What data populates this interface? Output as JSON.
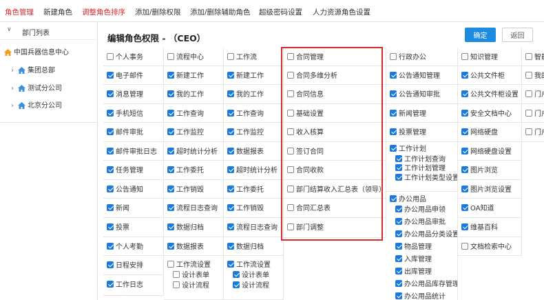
{
  "topnav": {
    "items": [
      "角色管理",
      "新建角色",
      "调整角色排序",
      "添加/删除权限",
      "添加/删除辅助角色",
      "超级密码设置",
      "人力资源角色设置"
    ]
  },
  "sidebar": {
    "title": "部门列表",
    "root": "中国兵器信息中心",
    "nodes": [
      "集团总部",
      "测试分公司",
      "北京分公司"
    ]
  },
  "main": {
    "title": "编辑角色权限 - （CEO）",
    "confirm_label": "确定",
    "return_label": "返回"
  },
  "columns": [
    {
      "cells": [
        {
          "items": [
            {
              "label": "个人事务",
              "checked": false
            }
          ]
        },
        {
          "items": [
            {
              "label": "电子邮件",
              "checked": true
            }
          ]
        },
        {
          "items": [
            {
              "label": "消息管理",
              "checked": true
            }
          ]
        },
        {
          "items": [
            {
              "label": "手机短信",
              "checked": true
            }
          ]
        },
        {
          "items": [
            {
              "label": "邮件审批",
              "checked": true
            }
          ]
        },
        {
          "items": [
            {
              "label": "邮件审批日志",
              "checked": true
            }
          ]
        },
        {
          "items": [
            {
              "label": "任务管理",
              "checked": true
            }
          ]
        },
        {
          "items": [
            {
              "label": "公告通知",
              "checked": true
            }
          ]
        },
        {
          "items": [
            {
              "label": "新闻",
              "checked": true
            }
          ]
        },
        {
          "items": [
            {
              "label": "投票",
              "checked": true
            }
          ]
        },
        {
          "items": [
            {
              "label": "个人考勤",
              "checked": true
            }
          ]
        },
        {
          "items": [
            {
              "label": "日程安排",
              "checked": true
            }
          ]
        },
        {
          "items": [
            {
              "label": "工作日志",
              "checked": true
            }
          ]
        }
      ]
    },
    {
      "cells": [
        {
          "items": [
            {
              "label": "流程中心",
              "checked": false
            }
          ]
        },
        {
          "items": [
            {
              "label": "新建工作",
              "checked": true
            }
          ]
        },
        {
          "items": [
            {
              "label": "我的工作",
              "checked": true
            }
          ]
        },
        {
          "items": [
            {
              "label": "工作查询",
              "checked": true
            }
          ]
        },
        {
          "items": [
            {
              "label": "工作监控",
              "checked": true
            }
          ]
        },
        {
          "items": [
            {
              "label": "超时统计分析",
              "checked": true
            }
          ]
        },
        {
          "items": [
            {
              "label": "工作委托",
              "checked": true
            }
          ]
        },
        {
          "items": [
            {
              "label": "工作销毁",
              "checked": true
            }
          ]
        },
        {
          "items": [
            {
              "label": "流程日志查询",
              "checked": true
            }
          ]
        },
        {
          "items": [
            {
              "label": "数据归档",
              "checked": true
            }
          ]
        },
        {
          "items": [
            {
              "label": "数据报表",
              "checked": true
            }
          ]
        },
        {
          "items": [
            {
              "label": "工作流设置",
              "checked": false
            },
            {
              "label": "设计表单",
              "checked": false
            },
            {
              "label": "设计流程",
              "checked": false
            }
          ]
        }
      ]
    },
    {
      "cells": [
        {
          "items": [
            {
              "label": "工作流",
              "checked": false
            }
          ]
        },
        {
          "items": [
            {
              "label": "新建工作",
              "checked": true
            }
          ]
        },
        {
          "items": [
            {
              "label": "我的工作",
              "checked": true
            }
          ]
        },
        {
          "items": [
            {
              "label": "工作查询",
              "checked": true
            }
          ]
        },
        {
          "items": [
            {
              "label": "工作监控",
              "checked": true
            }
          ]
        },
        {
          "items": [
            {
              "label": "数据报表",
              "checked": true
            }
          ]
        },
        {
          "items": [
            {
              "label": "超时统计分析",
              "checked": true
            }
          ]
        },
        {
          "items": [
            {
              "label": "工作委托",
              "checked": true
            }
          ]
        },
        {
          "items": [
            {
              "label": "工作销毁",
              "checked": true
            }
          ]
        },
        {
          "items": [
            {
              "label": "流程日志查询",
              "checked": true
            }
          ]
        },
        {
          "items": [
            {
              "label": "数据归档",
              "checked": true
            }
          ]
        },
        {
          "items": [
            {
              "label": "工作流设置",
              "checked": true
            },
            {
              "label": "设计表单",
              "checked": true
            },
            {
              "label": "设计流程",
              "checked": true
            }
          ]
        }
      ]
    },
    {
      "cells": [
        {
          "items": [
            {
              "label": "合同管理",
              "checked": false
            }
          ]
        },
        {
          "items": [
            {
              "label": "合同多维分析",
              "checked": false
            }
          ]
        },
        {
          "items": [
            {
              "label": "合同信息",
              "checked": false
            }
          ]
        },
        {
          "items": [
            {
              "label": "基础设置",
              "checked": false
            }
          ]
        },
        {
          "items": [
            {
              "label": "收入核算",
              "checked": false
            }
          ]
        },
        {
          "items": [
            {
              "label": "签订合同",
              "checked": false
            }
          ]
        },
        {
          "items": [
            {
              "label": "合同收款",
              "checked": false
            }
          ]
        },
        {
          "items": [
            {
              "label": "部门结算收入汇总表（领导）",
              "checked": false
            }
          ]
        },
        {
          "items": [
            {
              "label": "合同汇总表",
              "checked": false
            }
          ]
        },
        {
          "items": [
            {
              "label": "部门调整",
              "checked": false
            }
          ]
        }
      ]
    },
    {
      "cells": [
        {
          "items": [
            {
              "label": "行政办公",
              "checked": false
            }
          ]
        },
        {
          "items": [
            {
              "label": "公告通知管理",
              "checked": true
            }
          ]
        },
        {
          "items": [
            {
              "label": "公告通知审批",
              "checked": true
            }
          ]
        },
        {
          "items": [
            {
              "label": "新闻管理",
              "checked": true
            }
          ]
        },
        {
          "items": [
            {
              "label": "投票管理",
              "checked": true
            }
          ]
        },
        {
          "items": [
            {
              "label": "工作计划",
              "checked": true
            },
            {
              "label": "工作计划查询",
              "checked": true
            },
            {
              "label": "工作计划管理",
              "checked": true
            },
            {
              "label": "工作计划类型设置",
              "checked": true
            }
          ]
        },
        {
          "items": [
            {
              "label": "办公用品",
              "checked": true
            },
            {
              "label": "办公用品申领",
              "checked": true
            },
            {
              "label": "办公用品审批",
              "checked": true
            },
            {
              "label": "办公用品分类设置",
              "checked": true
            },
            {
              "label": "物品管理",
              "checked": true
            },
            {
              "label": "入库管理",
              "checked": true
            },
            {
              "label": "出库管理",
              "checked": true
            },
            {
              "label": "办公用品库存管理",
              "checked": true
            },
            {
              "label": "办公用品统计",
              "checked": true
            }
          ]
        }
      ]
    },
    {
      "cells": [
        {
          "items": [
            {
              "label": "知识管理",
              "checked": false
            }
          ]
        },
        {
          "items": [
            {
              "label": "公共文件柜",
              "checked": true
            }
          ]
        },
        {
          "items": [
            {
              "label": "公共文件柜设置",
              "checked": true
            }
          ]
        },
        {
          "items": [
            {
              "label": "安全文档中心",
              "checked": true
            }
          ]
        },
        {
          "items": [
            {
              "label": "网络硬盘",
              "checked": true
            }
          ]
        },
        {
          "items": [
            {
              "label": "网络硬盘设置",
              "checked": true
            }
          ]
        },
        {
          "items": [
            {
              "label": "图片浏览",
              "checked": true
            }
          ]
        },
        {
          "items": [
            {
              "label": "图片浏览设置",
              "checked": true
            }
          ]
        },
        {
          "items": [
            {
              "label": "OA知道",
              "checked": true
            }
          ]
        },
        {
          "items": [
            {
              "label": "维基百科",
              "checked": true
            }
          ]
        },
        {
          "items": [
            {
              "label": "文档检索中心",
              "checked": false
            }
          ]
        }
      ]
    },
    {
      "cells": [
        {
          "items": [
            {
              "label": "智能",
              "checked": false
            }
          ]
        },
        {
          "items": [
            {
              "label": "我的",
              "checked": false
            }
          ]
        },
        {
          "items": [
            {
              "label": "门户",
              "checked": false
            }
          ]
        },
        {
          "items": [
            {
              "label": "门户",
              "checked": false
            }
          ]
        },
        {
          "items": [
            {
              "label": "门户",
              "checked": false
            }
          ]
        }
      ]
    }
  ],
  "colors": {
    "accent": "#1d8ce0",
    "red": "#d9292b",
    "checkbox": "#1e7ad8"
  }
}
